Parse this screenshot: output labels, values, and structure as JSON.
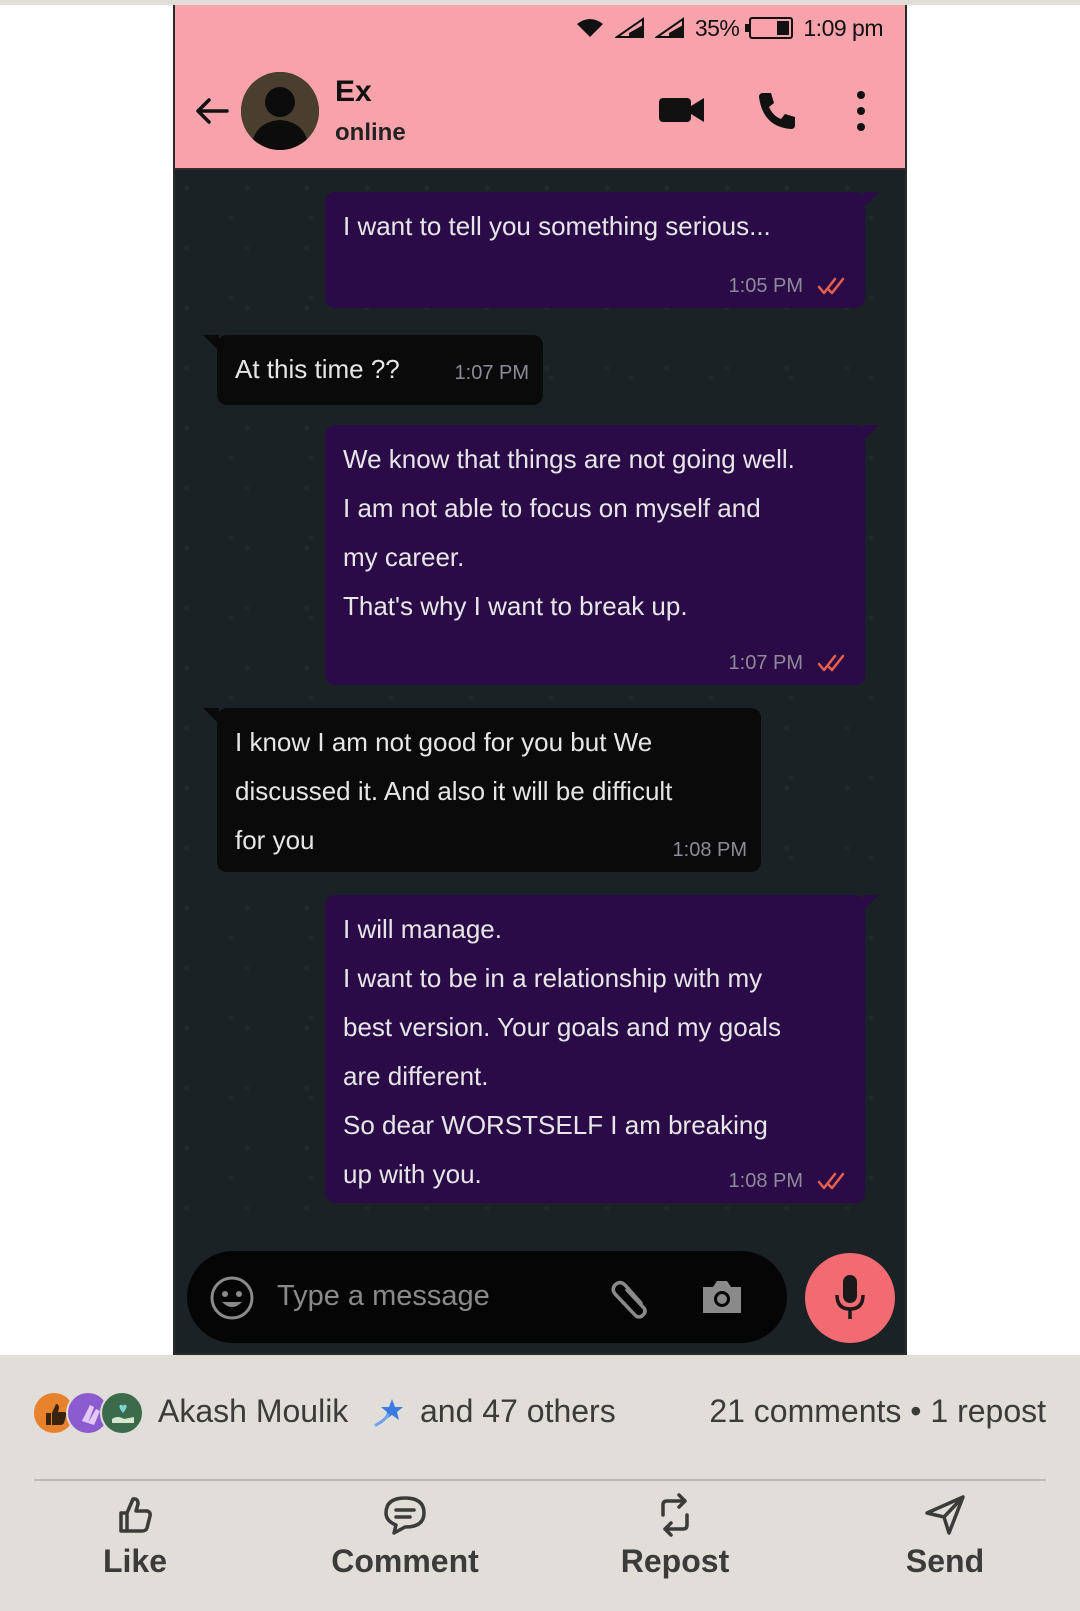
{
  "status_bar": {
    "battery": "35%",
    "time": "1:09 pm"
  },
  "header": {
    "contact_name": "Ex",
    "contact_status": "online"
  },
  "messages": [
    {
      "direction": "out",
      "lines": [
        "I want to tell you something serious..."
      ],
      "time": "1:05 PM"
    },
    {
      "direction": "in",
      "lines": [
        "At this time ??"
      ],
      "time": "1:07 PM"
    },
    {
      "direction": "out",
      "lines": [
        "We know that things are not going well.",
        "I am not able to focus on myself and",
        "my career.",
        "That's why I want to break up."
      ],
      "time": "1:07 PM"
    },
    {
      "direction": "in",
      "lines": [
        "I know I am not good for you but We",
        "discussed it. And also it will be difficult",
        "for you"
      ],
      "time": "1:08 PM"
    },
    {
      "direction": "out",
      "lines": [
        "I will manage.",
        "I want to be in a relationship with my",
        "best version. Your goals and my goals",
        "are different.",
        "So dear WORSTSELF I am breaking",
        "up with you."
      ],
      "time": "1:08 PM"
    }
  ],
  "composer": {
    "placeholder": "Type a message"
  },
  "social": {
    "reactor_name": "Akash Moulik",
    "reactor_others": "and 47 others",
    "stats": "21 comments • 1 repost",
    "actions": {
      "like": "Like",
      "comment": "Comment",
      "repost": "Repost",
      "send": "Send"
    }
  },
  "colors": {
    "header_bg": "#f8a3ac",
    "outgoing_bubble": "#2b0b47",
    "incoming_bubble": "#0a0a0a",
    "mic_button": "#f26a72",
    "footer_bg": "#e1ddd9",
    "read_ticks": "#e8604c"
  }
}
